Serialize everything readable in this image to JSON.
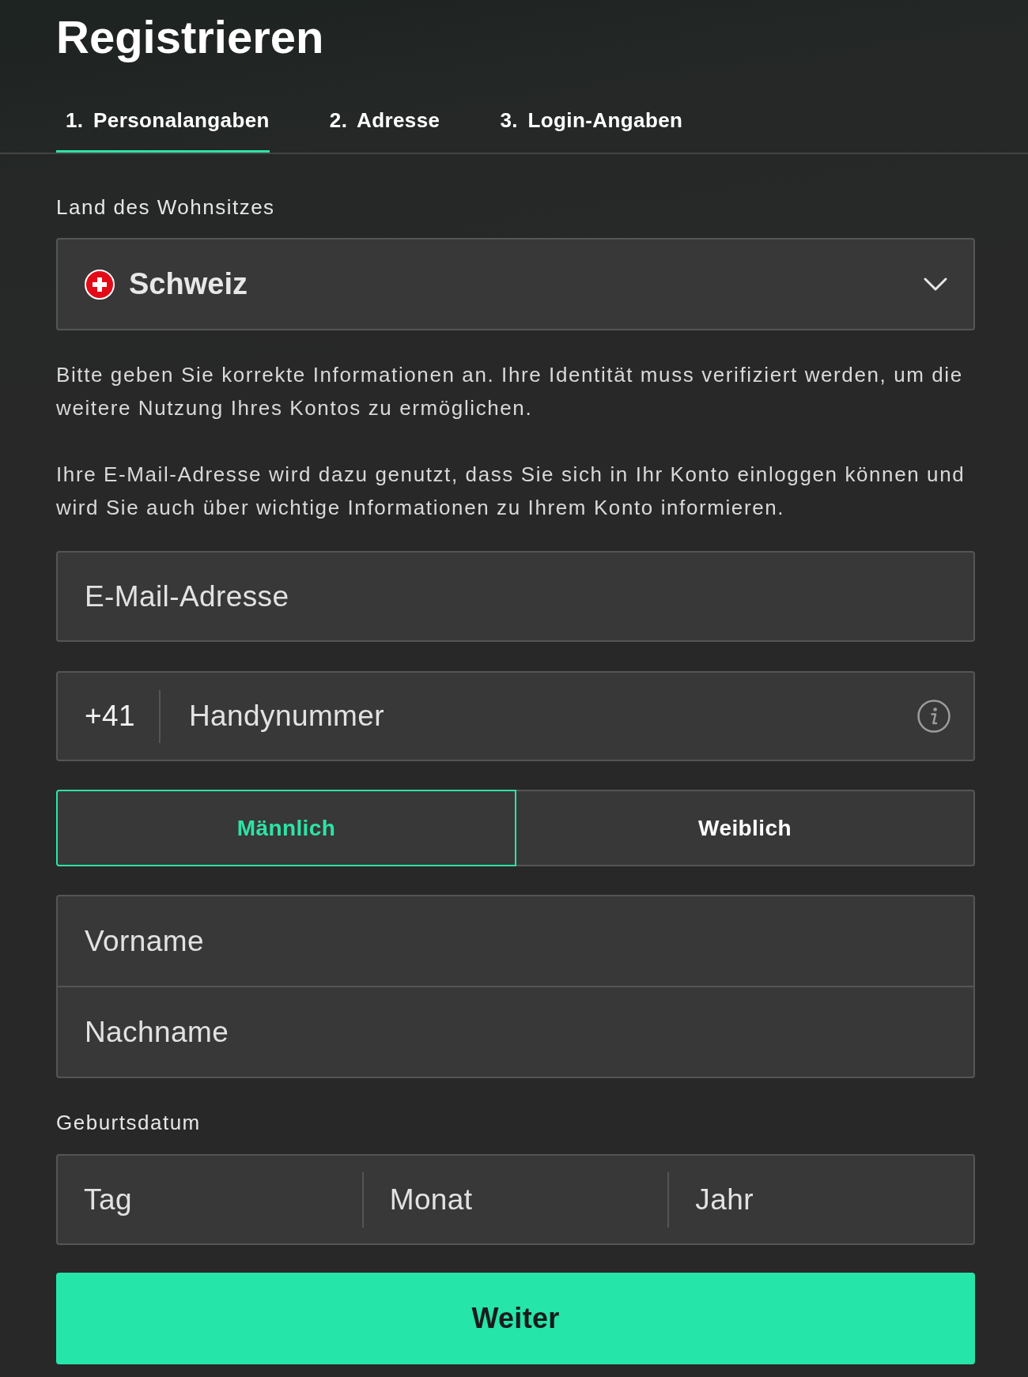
{
  "title": "Registrieren",
  "tabs": [
    {
      "label": "1. Personalangaben",
      "selected": true
    },
    {
      "label": "2. Adresse",
      "selected": false
    },
    {
      "label": "3. Login-Angaben",
      "selected": false
    }
  ],
  "country": {
    "label": "Land des Wohnsitzes",
    "value": "Schweiz"
  },
  "notices": [
    "Bitte geben Sie korrekte Informationen an. Ihre Identität muss verifiziert werden, um die weitere Nutzung Ihres Kontos zu ermöglichen.",
    "Ihre E-Mail-Adresse wird dazu genutzt, dass Sie sich in Ihr Konto einloggen können und wird Sie auch über wichtige Informationen zu Ihrem Konto informieren."
  ],
  "email": {
    "placeholder": "E-Mail-Adresse"
  },
  "phone": {
    "prefix": "+41",
    "placeholder": "Handynummer"
  },
  "gender": [
    {
      "label": "Männlich",
      "selected": true
    },
    {
      "label": "Weiblich",
      "selected": false
    }
  ],
  "name_fields": [
    {
      "placeholder": "Vorname"
    },
    {
      "placeholder": "Nachname"
    }
  ],
  "birth_date": {
    "label": "Geburtsdatum",
    "fields": [
      {
        "placeholder": "Tag"
      },
      {
        "placeholder": "Monat"
      },
      {
        "placeholder": "Jahr"
      }
    ]
  },
  "submit": {
    "label": "Weiter"
  }
}
